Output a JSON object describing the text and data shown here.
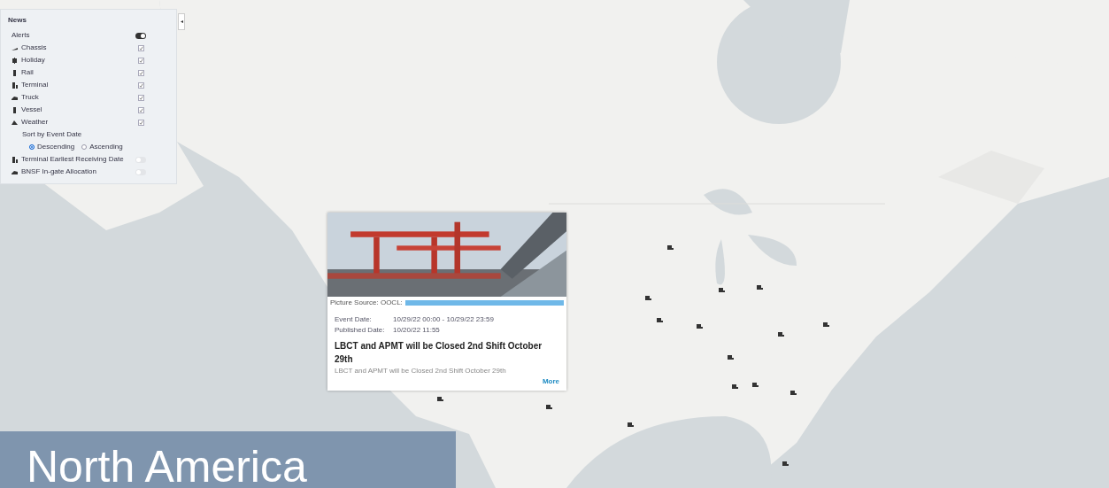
{
  "panel": {
    "title": "News",
    "alerts": {
      "label": "Alerts",
      "on": true
    },
    "categories": [
      {
        "label": "Chassis",
        "checked": true
      },
      {
        "label": "Holiday",
        "checked": true
      },
      {
        "label": "Rail",
        "checked": true
      },
      {
        "label": "Terminal",
        "checked": true
      },
      {
        "label": "Truck",
        "checked": true
      },
      {
        "label": "Vessel",
        "checked": true
      },
      {
        "label": "Weather",
        "checked": true
      }
    ],
    "sort": {
      "label": "Sort by Event Date",
      "options": [
        {
          "label": "Descending",
          "selected": true
        },
        {
          "label": "Ascending",
          "selected": false
        }
      ]
    },
    "layers": [
      {
        "label": "Terminal Earliest Receiving Date",
        "on": false
      },
      {
        "label": "BNSF In-gate Allocation",
        "on": false
      }
    ]
  },
  "collapse_button": {
    "glyph": "◂"
  },
  "popup": {
    "source_label": "Picture Source: OOCL:",
    "fields": [
      {
        "label": "Event Date:",
        "value": "10/29/22 00:00 - 10/29/22 23:59"
      },
      {
        "label": "Published Date:",
        "value": "10/20/22 11:55"
      }
    ],
    "title": "LBCT and APMT will be Closed 2nd Shift October 29th",
    "summary": "LBCT and APMT will be Closed 2nd Shift October 29th",
    "more": "More"
  },
  "region_title": "North America"
}
